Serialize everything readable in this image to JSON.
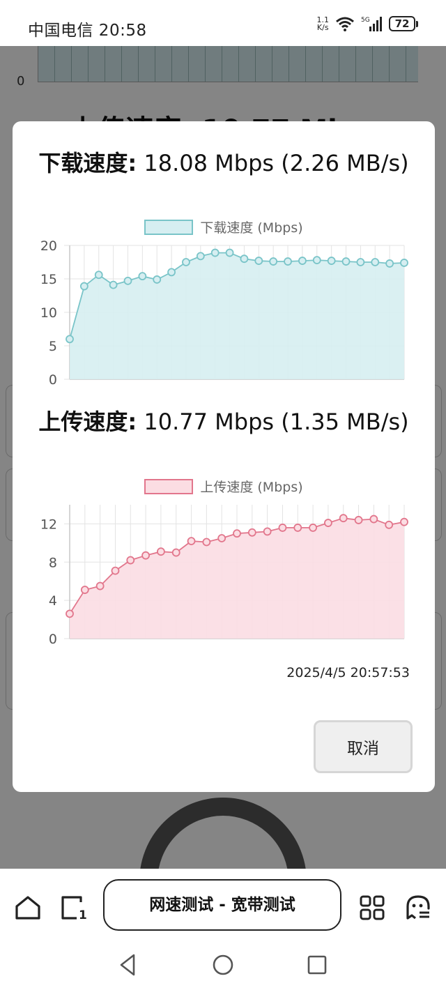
{
  "status_bar": {
    "carrier_time": "中国电信 20:58",
    "net_rate_value": "1.1",
    "net_rate_unit": "K/s",
    "battery": "72"
  },
  "background": {
    "axis_zero": "0",
    "upload_title_partial": "上传速度: 10.77 Mb"
  },
  "modal": {
    "download": {
      "title_label": "下载速度:",
      "title_value": " 18.08 Mbps (2.26 MB/s)",
      "legend": "下载速度 (Mbps)"
    },
    "upload": {
      "title_label": "上传速度:",
      "title_value": " 10.77 Mbps (1.35 MB/s)",
      "legend": "上传速度 (Mbps)"
    },
    "timestamp": "2025/4/5 20:57:53",
    "cancel_label": "取消"
  },
  "browser_bar": {
    "url_title": "网速测试 - 宽带测试",
    "home_icon": "home-icon",
    "tabs_icon": "tabs-icon",
    "tab_count": "1",
    "apps_icon": "apps-grid-icon",
    "menu_icon": "ghost-menu-icon"
  },
  "colors": {
    "download_line": "#79c4c8",
    "download_fill": "#d6eef1",
    "upload_line": "#e2768c",
    "upload_fill": "#fbdde3"
  },
  "chart_data": [
    {
      "type": "area",
      "series": [
        {
          "name": "下载速度 (Mbps)",
          "values": [
            6.0,
            13.9,
            15.6,
            14.1,
            14.7,
            15.4,
            14.9,
            16.0,
            17.5,
            18.4,
            18.9,
            18.9,
            18.0,
            17.7,
            17.6,
            17.6,
            17.7,
            17.8,
            17.7,
            17.6,
            17.5,
            17.5,
            17.3,
            17.4
          ]
        }
      ],
      "ylim": [
        0,
        20
      ],
      "yticks": [
        0,
        5,
        10,
        15,
        20
      ],
      "ytick_labels": [
        "0",
        "5",
        "10",
        "15",
        "20"
      ],
      "grid": true,
      "legend_position": "top"
    },
    {
      "type": "area",
      "series": [
        {
          "name": "上传速度 (Mbps)",
          "values": [
            2.6,
            5.1,
            5.5,
            7.1,
            8.2,
            8.7,
            9.1,
            9.0,
            10.2,
            10.1,
            10.5,
            11.0,
            11.1,
            11.2,
            11.6,
            11.6,
            11.6,
            12.1,
            12.6,
            12.4,
            12.5,
            11.9,
            12.2
          ]
        }
      ],
      "ylim": [
        0,
        14
      ],
      "yticks": [
        0,
        4,
        8,
        12
      ],
      "ytick_labels": [
        "0",
        "4",
        "8",
        "12"
      ],
      "grid": true,
      "legend_position": "top"
    }
  ]
}
